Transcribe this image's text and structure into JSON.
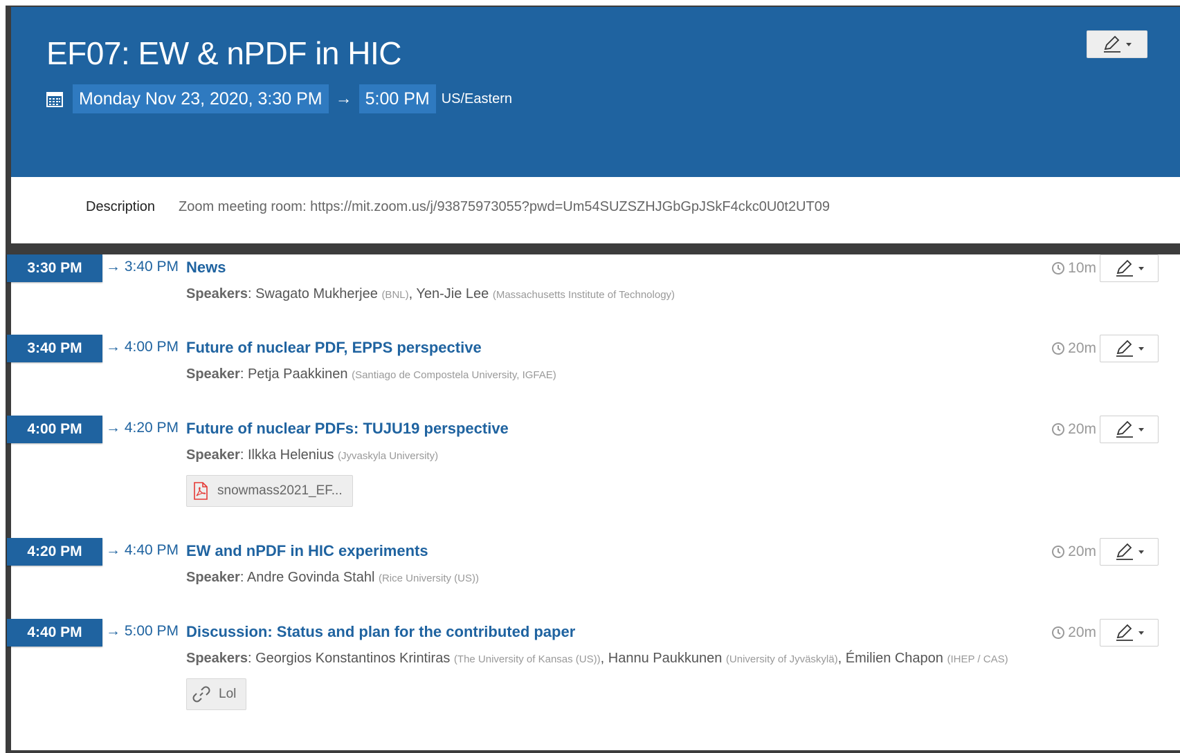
{
  "event": {
    "title": "EF07: EW & nPDF in HIC",
    "start_datetime": "Monday Nov 23, 2020, 3:30 PM",
    "end_time": "5:00 PM",
    "arrow": "→",
    "timezone": "US/Eastern"
  },
  "description": {
    "label": "Description",
    "text": "Zoom meeting room: https://mit.zoom.us/j/93875973055?pwd=Um54SUZSZHJGbGpJSkF4ckc0U0t2UT09"
  },
  "entries": [
    {
      "start": "3:30 PM",
      "end": "→ 3:40 PM",
      "title": "News",
      "duration": "10m",
      "speaker_label": "Speakers",
      "speakers": [
        {
          "name": "Swagato Mukherjee",
          "aff": "(BNL)",
          "sep": ", "
        },
        {
          "name": "Yen-Jie Lee",
          "aff": "(Massachusetts Institute of Technology)",
          "sep": ""
        }
      ]
    },
    {
      "start": "3:40 PM",
      "end": "→ 4:00 PM",
      "title": "Future of nuclear PDF, EPPS perspective",
      "duration": "20m",
      "speaker_label": "Speaker",
      "speakers": [
        {
          "name": "Petja Paakkinen",
          "aff": "(Santiago de Compostela University, IGFAE)",
          "sep": ""
        }
      ]
    },
    {
      "start": "4:00 PM",
      "end": "→ 4:20 PM",
      "title": "Future of nuclear PDFs: TUJU19 perspective",
      "duration": "20m",
      "speaker_label": "Speaker",
      "speakers": [
        {
          "name": "Ilkka Helenius",
          "aff": "(Jyvaskyla University)",
          "sep": ""
        }
      ],
      "attachment": {
        "label": "snowmass2021_EF...",
        "icon": "pdf-icon"
      }
    },
    {
      "start": "4:20 PM",
      "end": "→ 4:40 PM",
      "title": "EW and nPDF in HIC experiments",
      "duration": "20m",
      "speaker_label": "Speaker",
      "speakers": [
        {
          "name": "Andre Govinda Stahl",
          "aff": "(Rice University (US))",
          "sep": ""
        }
      ]
    },
    {
      "start": "4:40 PM",
      "end": "→ 5:00 PM",
      "title": "Discussion: Status and plan for the contributed paper",
      "duration": "20m",
      "speaker_label": "Speakers",
      "speakers": [
        {
          "name": "Georgios Konstantinos Krintiras",
          "aff": "(The University of Kansas (US))",
          "sep": ", "
        },
        {
          "name": "Hannu Paukkunen",
          "aff": "(University of Jyväskylä)",
          "sep": ", "
        },
        {
          "name": "Émilien Chapon",
          "aff": "(IHEP / CAS)",
          "sep": ""
        }
      ],
      "attachment": {
        "label": "Lol",
        "icon": "link-icon"
      }
    }
  ],
  "colors": {
    "header_blue": "#1f63a0",
    "chip_blue": "#2f7ac0",
    "frame_dark": "#3c3c3c"
  }
}
